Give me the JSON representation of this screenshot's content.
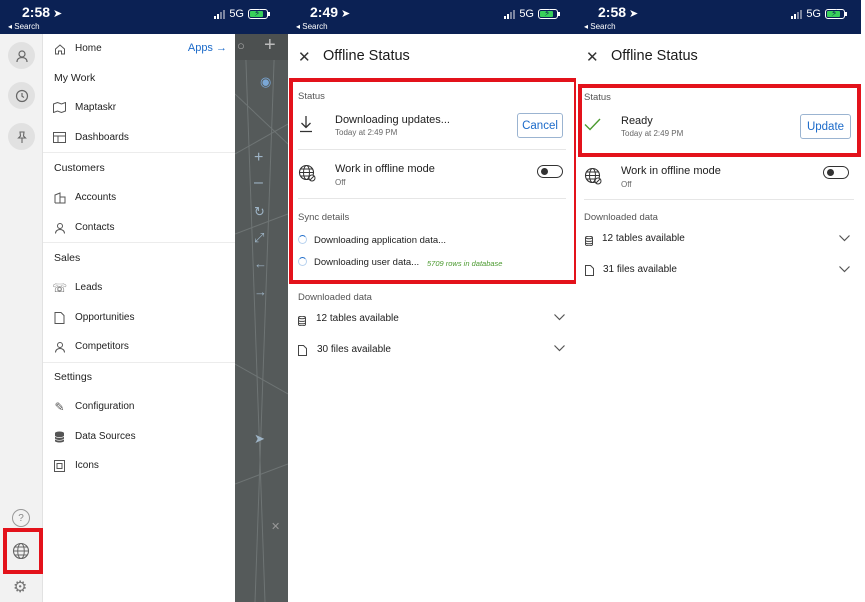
{
  "panel1": {
    "status": {
      "time": "2:58",
      "back": "◂ Search",
      "network": "5G"
    },
    "menu": {
      "home": "Home",
      "apps": "Apps",
      "sections": {
        "my_work": "My Work",
        "customers": "Customers",
        "sales": "Sales",
        "settings": "Settings"
      },
      "items": {
        "maptaskr": "Maptaskr",
        "dashboards": "Dashboards",
        "accounts": "Accounts",
        "contacts": "Contacts",
        "leads": "Leads",
        "opportunities": "Opportunities",
        "competitors": "Competitors",
        "configuration": "Configuration",
        "data_sources": "Data Sources",
        "icons": "Icons"
      }
    }
  },
  "panel2": {
    "status": {
      "time": "2:49",
      "back": "◂ Search",
      "network": "5G"
    },
    "title": "Offline Status",
    "status_label": "Status",
    "downloading": "Downloading updates...",
    "downloading_time": "Today at 2:49 PM",
    "cancel": "Cancel",
    "offline_mode": "Work in offline mode",
    "offline_state": "Off",
    "sync_details": "Sync details",
    "sync_app": "Downloading application data...",
    "sync_user": "Downloading user data...",
    "sync_rows": "5709 rows in database",
    "downloaded_data": "Downloaded data",
    "tables": "12 tables available",
    "files": "30 files available"
  },
  "panel3": {
    "status": {
      "time": "2:58",
      "back": "◂ Search",
      "network": "5G"
    },
    "title": "Offline Status",
    "status_label": "Status",
    "ready": "Ready",
    "ready_time": "Today at 2:49 PM",
    "update": "Update",
    "offline_mode": "Work in offline mode",
    "offline_state": "Off",
    "downloaded_data": "Downloaded data",
    "tables": "12 tables available",
    "files": "31 files available"
  },
  "colors": {
    "accent": "#1b6ac9",
    "highlight": "#e3121b",
    "statusbar": "#0b2154",
    "success": "#4b9a2f"
  }
}
